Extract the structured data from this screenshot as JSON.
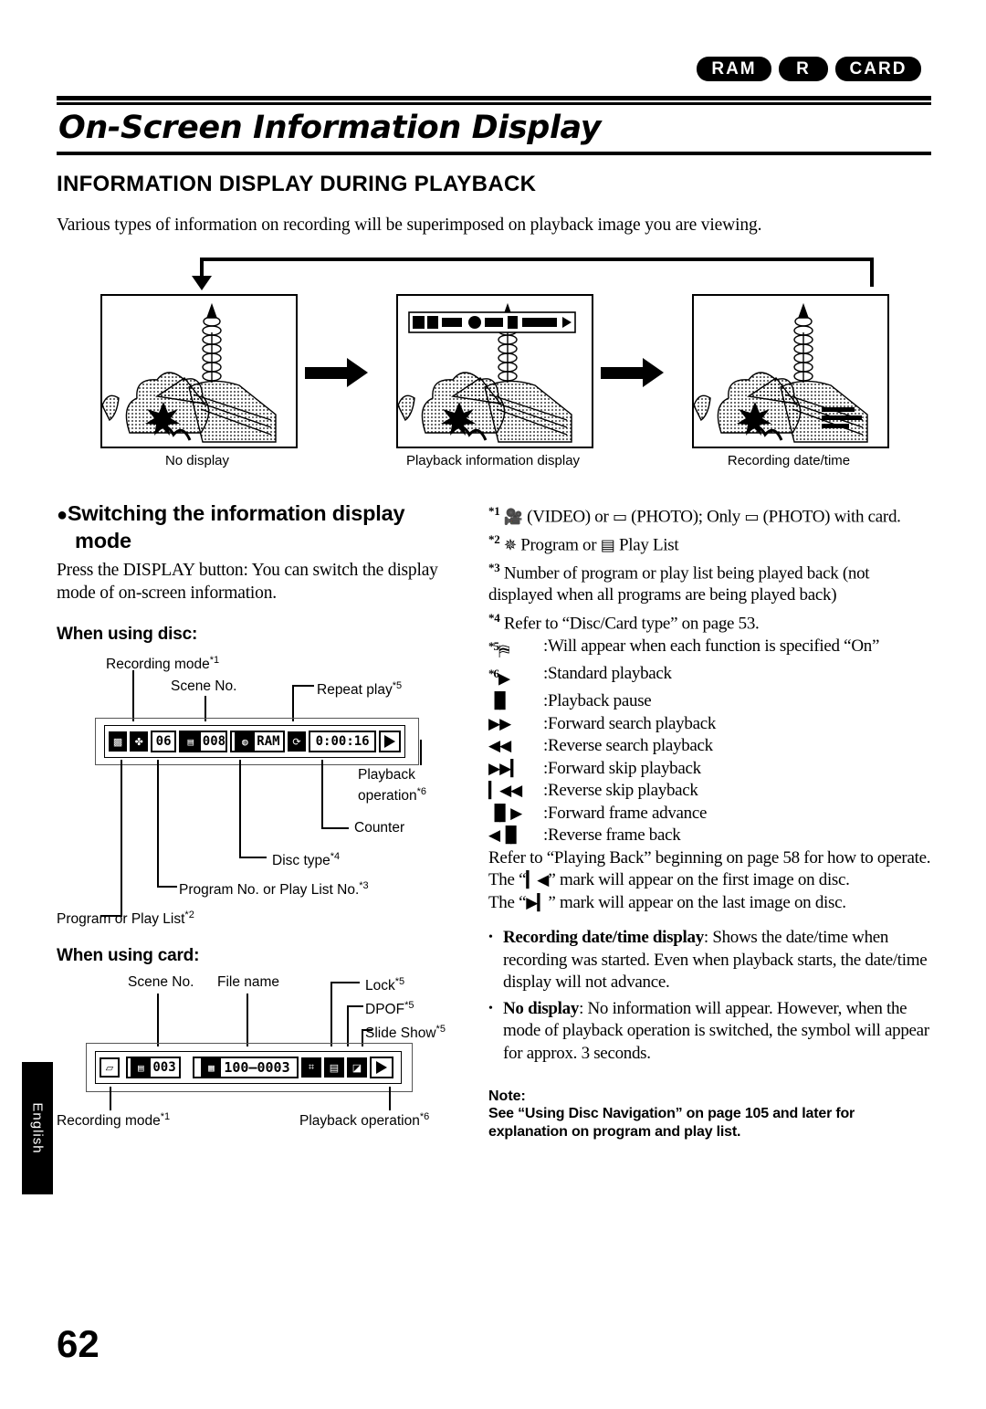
{
  "badges": [
    {
      "label": "RAM",
      "cls": "b-ram"
    },
    {
      "label": "R",
      "cls": "b-r"
    },
    {
      "label": "CARD",
      "cls": "b-card"
    }
  ],
  "title": "On-Screen Information Display",
  "section_head": "INFORMATION DISPLAY DURING PLAYBACK",
  "intro": "Various types of information on recording will be superimposed on playback image you are viewing.",
  "flow": {
    "captions": [
      "No display",
      "Playback information display",
      "Recording date/time"
    ]
  },
  "left": {
    "switch_head_1": "Switching the information display",
    "switch_head_2": "mode",
    "switch_body": "Press the DISPLAY button: You can switch the display mode of on-screen information.",
    "disc_head": "When using disc:",
    "card_head": "When using card:",
    "disc_labels": {
      "recording_mode": "Recording mode",
      "recording_mode_sup": "*1",
      "scene_no": "Scene No.",
      "repeat_play": "Repeat play",
      "repeat_play_sup": "*5",
      "playback_operation_1": "Playback",
      "playback_operation_2": "operation",
      "playback_operation_sup": "*6",
      "counter": "Counter",
      "disc_type": "Disc type",
      "disc_type_sup": "*4",
      "program_no": "Program No. or Play List No.",
      "program_no_sup": "*3",
      "program_or_playlist": "Program or Play List",
      "program_or_playlist_sup": "*2"
    },
    "disc_osd": {
      "scene_no_value": "06",
      "program_no_value": "008",
      "disc_type_value": "RAM",
      "counter_value": "0:00:16"
    },
    "card_labels": {
      "scene_no": "Scene No.",
      "file_name": "File name",
      "lock": "Lock",
      "lock_sup": "*5",
      "dpof": "DPOF",
      "dpof_sup": "*5",
      "slide_show": "Slide Show",
      "slide_show_sup": "*5",
      "recording_mode": "Recording mode",
      "recording_mode_sup": "*1",
      "playback_operation": "Playback operation",
      "playback_operation_sup": "*6"
    },
    "card_osd": {
      "scene_no_value": "003",
      "file_name_value": "100—0003"
    }
  },
  "right": {
    "footnotes": [
      {
        "mark": "*1",
        "text": "%ICON_VIDEO% (VIDEO) or %ICON_PHOTO% (PHOTO); Only %ICON_PHOTO% (PHOTO) with card."
      },
      {
        "mark": "*2",
        "text": "%ICON_PROGRAM% Program or %ICON_PLAYLIST% Play List"
      },
      {
        "mark": "*3",
        "text": "Number of program or play list being played back (not displayed when all programs are being played back)"
      },
      {
        "mark": "*4",
        "text": "Refer to “Disc/Card type” on page 53."
      }
    ],
    "fn5": {
      "mark": "*5",
      "symbol": "⛿",
      "text": ":Will appear when each function is specified “On”"
    },
    "playback_symbols": [
      {
        "mark": "*6",
        "symbol": "▶",
        "text": ":Standard playback"
      },
      {
        "mark": "",
        "symbol": "▐▌",
        "text": ":Playback pause"
      },
      {
        "mark": "",
        "symbol": "▶▶",
        "text": ":Forward search playback"
      },
      {
        "mark": "",
        "symbol": "◀◀",
        "text": ":Reverse search playback"
      },
      {
        "mark": "",
        "symbol": "▶▶▎",
        "text": ":Forward skip playback"
      },
      {
        "mark": "",
        "symbol": "▎◀◀",
        "text": ":Reverse skip playback"
      },
      {
        "mark": "",
        "symbol": "▐▌▶",
        "text": ":Forward frame advance"
      },
      {
        "mark": "",
        "symbol": "◀▐▌",
        "text": ":Reverse frame back"
      }
    ],
    "refer_text": "Refer to “Playing Back” beginning on page 58 for how to operate.",
    "first_image_text_a": "The “",
    "first_image_symbol": "▎◀",
    "first_image_text_b": "” mark will appear on the first image on disc.",
    "last_image_text_a": "The “",
    "last_image_symbol": "▶▎",
    "last_image_text_b": "” mark will appear on the last image on disc.",
    "bullets": [
      {
        "strong": "Recording date/time display",
        "text": ": Shows the date/time when recording was started. Even when playback starts, the date/time display will not advance."
      },
      {
        "strong": "No display",
        "text": ": No information will appear. However, when the mode of playback operation is switched, the symbol will appear for approx. 3 seconds."
      }
    ],
    "note_head": "Note:",
    "note_body": "See “Using Disc Navigation” on page 105 and later for explanation on program and play list."
  },
  "side_tab": "English",
  "page_number": "62"
}
